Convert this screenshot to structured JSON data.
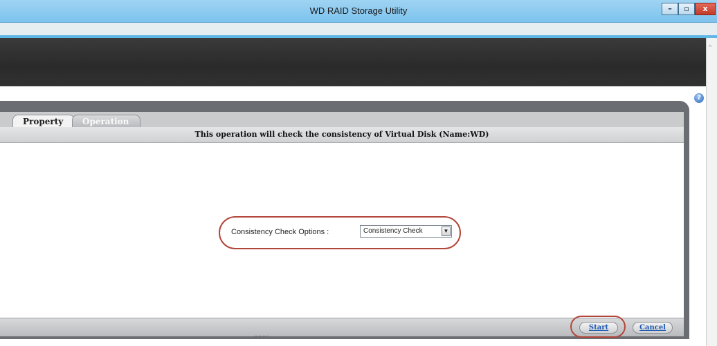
{
  "window": {
    "title": "WD RAID Storage Utility",
    "controls": {
      "minimize": "–",
      "maximize": "▫",
      "close": "x"
    }
  },
  "help_icon": "?",
  "scrollbar": {
    "up_arrow": "^"
  },
  "tabs": [
    {
      "label": "Property",
      "active": true
    },
    {
      "label": "Operation",
      "active": false
    }
  ],
  "header": {
    "message": "This operation will check the consistency of Virtual Disk (Name:WD)"
  },
  "options": {
    "label": "Consistency Check Options :",
    "select_value": "Consistency Check",
    "dropdown_glyph": "▼"
  },
  "buttons": {
    "start": "Start",
    "cancel": "Cancel"
  },
  "colors": {
    "titlebar": "#7cc3ee",
    "banner": "#2e2e2e",
    "frame": "#6a6e72",
    "highlight_ring": "#b3463a",
    "link_text": "#1b57b0"
  }
}
